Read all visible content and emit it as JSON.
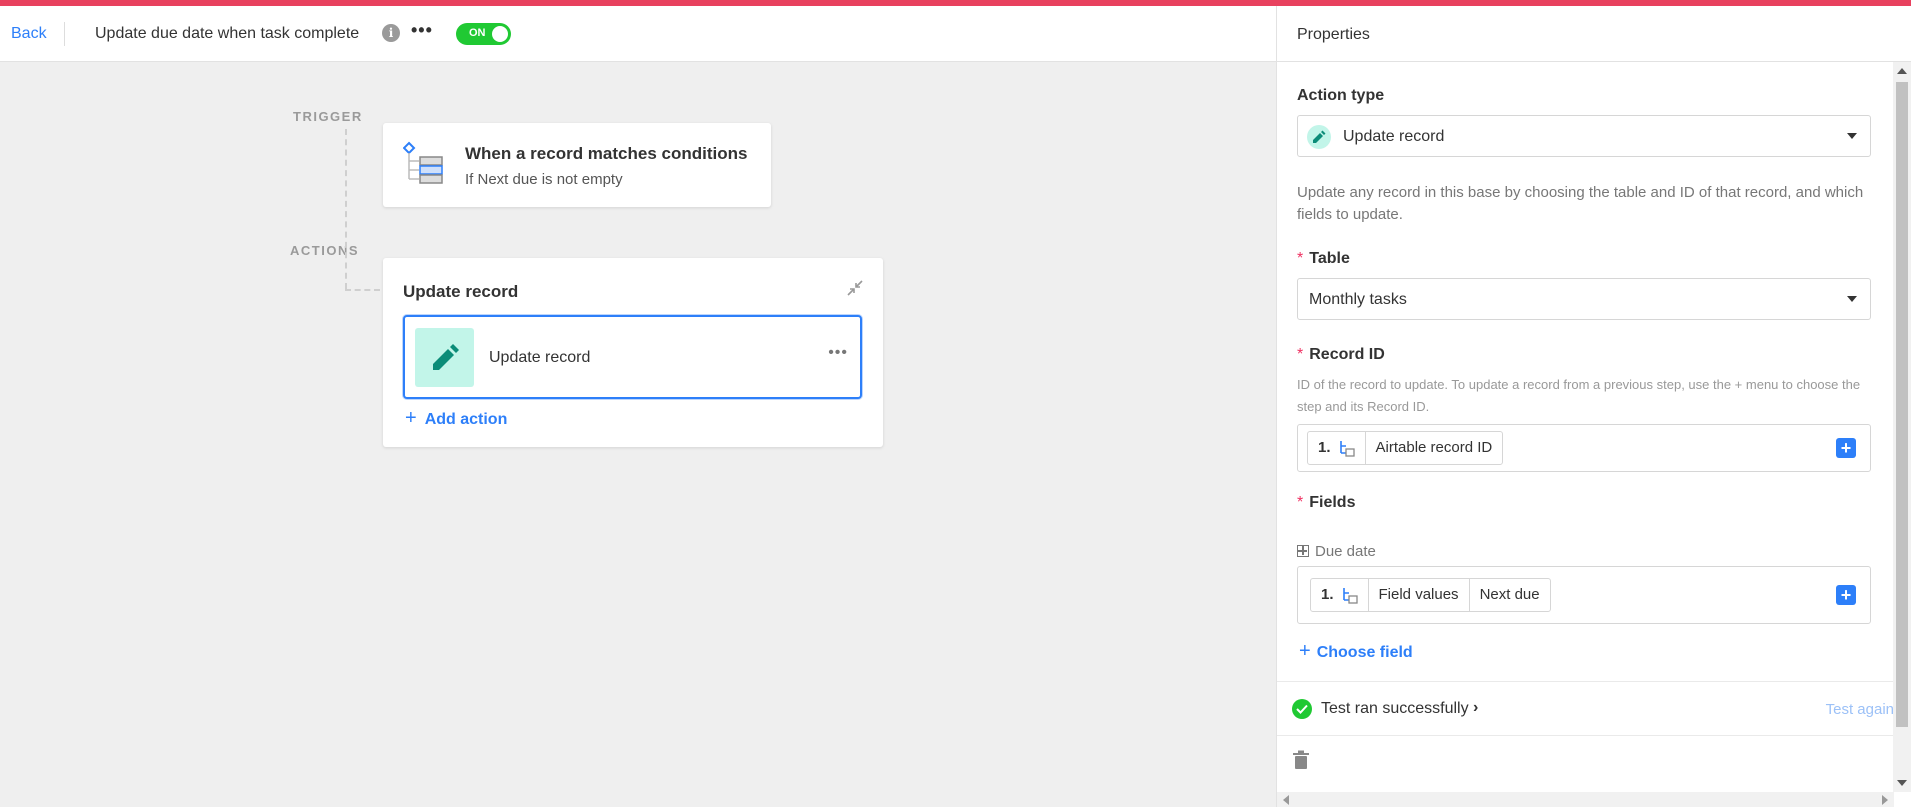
{
  "header": {
    "back_label": "Back",
    "title": "Update due date when task complete",
    "toggle_label": "ON",
    "toggle_color": "#20c933",
    "accent_color": "#e8415e"
  },
  "canvas": {
    "trigger_label": "TRIGGER",
    "actions_label": "ACTIONS",
    "trigger_card": {
      "title": "When a record matches conditions",
      "subtitle": "If Next due is not empty"
    },
    "action_card": {
      "title": "Update record",
      "step_label": "Update record",
      "add_action_label": "Add action"
    }
  },
  "panel": {
    "title": "Properties",
    "action_type": {
      "label": "Action type",
      "value": "Update record"
    },
    "description": "Update any record in this base by choosing the table and ID of that record, and which fields to update.",
    "table": {
      "label": "Table",
      "value": "Monthly tasks"
    },
    "record_id": {
      "label": "Record ID",
      "hint": "ID of the record to update. To update a record from a previous step, use the + menu to choose the step and its Record ID.",
      "token_step": "1.",
      "token_value": "Airtable record ID"
    },
    "fields": {
      "label": "Fields",
      "field_name": "Due date",
      "token_step": "1.",
      "token_path_1": "Field values",
      "token_path_2": "Next due",
      "choose_field_label": "Choose field"
    },
    "test": {
      "status": "Test ran successfully",
      "again_label": "Test again"
    }
  }
}
